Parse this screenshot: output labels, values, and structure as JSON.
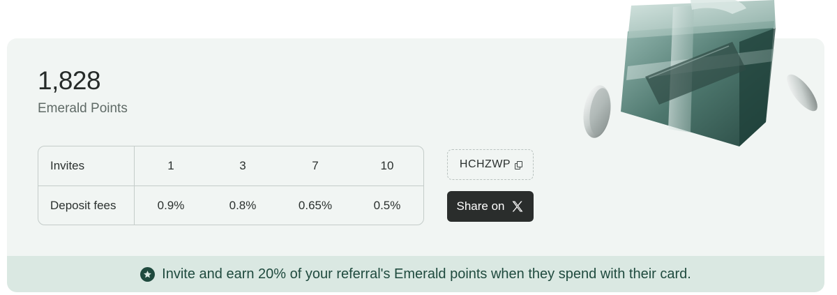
{
  "points": {
    "value": "1,828",
    "label": "Emerald Points"
  },
  "tiers": {
    "row_headers": [
      "Invites",
      "Deposit fees"
    ],
    "invites": [
      "1",
      "3",
      "7",
      "10"
    ],
    "deposit_fees": [
      "0.9%",
      "0.8%",
      "0.65%",
      "0.5%"
    ]
  },
  "referral": {
    "code": "HCHZWP",
    "copy_icon": "copy-icon",
    "share_label": "Share on",
    "share_icon": "x-logo-icon"
  },
  "banner": {
    "icon": "star-circle-icon",
    "text": "Invite and earn 20% of your referral's Emerald points when they spend with their card."
  },
  "colors": {
    "card_bg": "#f1f5f3",
    "banner_bg": "#dae8e2",
    "banner_text": "#1f4a3e",
    "button_bg": "#2a2d2c"
  }
}
